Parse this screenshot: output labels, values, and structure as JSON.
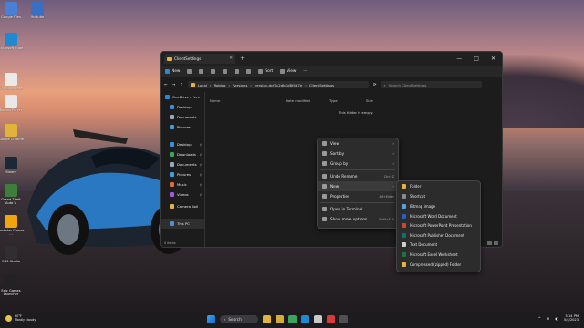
{
  "desktop": {
    "icons": [
      {
        "label": "Google Files",
        "color": "#4a7fd6"
      },
      {
        "label": "Youtube",
        "color": "#3a6fc2"
      },
      {
        "label": "Microsoft Edge",
        "color": "#1f8ad1"
      },
      {
        "label": "Shutdown.exe",
        "color": "#eaeaea"
      },
      {
        "label": "Roblox Player",
        "color": "#e8e8e8"
      },
      {
        "label": "Google Chrome",
        "color": "#e2b33b"
      },
      {
        "label": "Steam",
        "color": "#1b2838"
      },
      {
        "label": "Grand Theft Auto V",
        "color": "#3f7d3a"
      },
      {
        "label": "Rockstar Games ...",
        "color": "#f2a40c"
      },
      {
        "label": "OBS Studio",
        "color": "#302e31"
      },
      {
        "label": "Epic Games Launcher",
        "color": "#222222"
      }
    ]
  },
  "explorer": {
    "tab_title": "ClientSettings",
    "tab_close": "✕",
    "new_tab": "+",
    "window_buttons": [
      "—",
      "□",
      "✕"
    ],
    "toolbar": {
      "new": "New",
      "sort": "Sort",
      "view": "View",
      "more": "···"
    },
    "address": {
      "segments": [
        "Local",
        "Roblox",
        "Versions",
        "version-dcf1c2db7d8f4b7e",
        "ClientSettings"
      ]
    },
    "search_placeholder": "Search ClientSettings",
    "sidebar": [
      {
        "label": "OneDrive - Pers",
        "icon": "onedrive-icon",
        "color": "#2b88d9"
      },
      {
        "label": "Desktop",
        "icon": "desktop-icon",
        "color": "#3a8ed6"
      },
      {
        "label": "Documents",
        "icon": "documents-icon",
        "color": "#9aa8b6"
      },
      {
        "label": "Pictures",
        "icon": "pictures-icon",
        "color": "#3f9fd8"
      },
      {
        "label": "Desktop",
        "icon": "desktop-icon",
        "color": "#3a8ed6"
      },
      {
        "label": "Downloads",
        "icon": "downloads-icon",
        "color": "#3aa55d"
      },
      {
        "label": "Documents",
        "icon": "documents-icon",
        "color": "#9aa8b6"
      },
      {
        "label": "Pictures",
        "icon": "pictures-icon",
        "color": "#3f9fd8"
      },
      {
        "label": "Music",
        "icon": "music-icon",
        "color": "#e06b3c"
      },
      {
        "label": "Videos",
        "icon": "videos-icon",
        "color": "#9b5bd6"
      },
      {
        "label": "Camera Roll",
        "icon": "folder-icon",
        "color": "#e3b341"
      },
      {
        "label": "This PC",
        "icon": "this-pc-icon",
        "color": "#4c8fd2"
      }
    ],
    "columns": [
      "Name",
      "Date modified",
      "Type",
      "Size"
    ],
    "empty_message": "This folder is empty.",
    "status": "0 items"
  },
  "context_menu": {
    "items": [
      {
        "label": "View",
        "arrow": "›",
        "shortcut": ""
      },
      {
        "label": "Sort by",
        "arrow": "›",
        "shortcut": ""
      },
      {
        "label": "Group by",
        "arrow": "›",
        "shortcut": ""
      },
      {
        "label": "Undo Rename",
        "arrow": "",
        "shortcut": "Ctrl+Z"
      },
      {
        "label": "New",
        "arrow": "›",
        "shortcut": ""
      },
      {
        "label": "Properties",
        "arrow": "",
        "shortcut": "Alt+Enter"
      },
      {
        "label": "Open in Terminal",
        "arrow": "",
        "shortcut": ""
      },
      {
        "label": "Show more options",
        "arrow": "",
        "shortcut": "Shift+F10"
      }
    ]
  },
  "new_submenu": {
    "items": [
      {
        "label": "Folder",
        "color": "#e3b341"
      },
      {
        "label": "Shortcut",
        "color": "#8a8a8a"
      },
      {
        "label": "Bitmap image",
        "color": "#5aa0d8"
      },
      {
        "label": "Microsoft Word Document",
        "color": "#2b5fb3"
      },
      {
        "label": "Microsoft PowerPoint Presentation",
        "color": "#d24726"
      },
      {
        "label": "Microsoft Publisher Document",
        "color": "#077568"
      },
      {
        "label": "Text Document",
        "color": "#cfcfcf"
      },
      {
        "label": "Microsoft Excel Worksheet",
        "color": "#1f7244"
      },
      {
        "label": "Compressed (zipped) Folder",
        "color": "#e3b341"
      }
    ]
  },
  "taskbar": {
    "weather_temp": "60°F",
    "weather_desc": "Mostly cloudy",
    "search_label": "Search",
    "time": "5:14 PM",
    "date": "5/4/2023",
    "apps": [
      {
        "name": "file-explorer-app",
        "color": "#e3b341"
      },
      {
        "name": "folder-app",
        "color": "#d9a93c"
      },
      {
        "name": "chrome-app",
        "color": "#3aa55d"
      },
      {
        "name": "edge-app",
        "color": "#1f8ad1"
      },
      {
        "name": "roblox-app",
        "color": "#c9c9c9"
      },
      {
        "name": "media-app",
        "color": "#d83b3b"
      },
      {
        "name": "obs-app",
        "color": "#505050"
      }
    ]
  }
}
